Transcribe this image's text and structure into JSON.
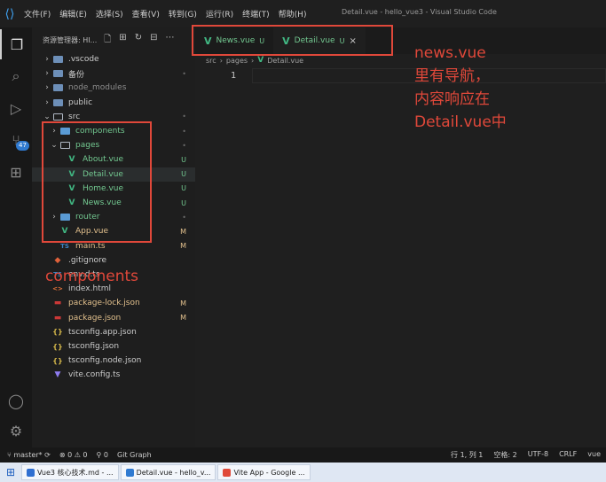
{
  "app": {
    "window_title": "Detail.vue - hello_vue3 - Visual Studio Code",
    "menu": [
      "文件(F)",
      "编辑(E)",
      "选择(S)",
      "查看(V)",
      "转到(G)",
      "运行(R)",
      "终端(T)",
      "帮助(H)"
    ]
  },
  "activity_bar": {
    "scm_badge": "47"
  },
  "explorer": {
    "header": "资源管理器: HI...",
    "tree": [
      {
        "label": ".vscode",
        "kind": "folder",
        "depth": 0,
        "chev": "›",
        "status": "",
        "color": "#cccccc"
      },
      {
        "label": "备份",
        "kind": "folder",
        "depth": 0,
        "chev": "›",
        "status": "•",
        "color": "#cccccc"
      },
      {
        "label": "node_modules",
        "kind": "folder",
        "depth": 0,
        "chev": "›",
        "status": "",
        "color": "#8c8c8c"
      },
      {
        "label": "public",
        "kind": "folder",
        "depth": 0,
        "chev": "›",
        "status": "",
        "color": "#cccccc"
      },
      {
        "label": "src",
        "kind": "folder-open",
        "depth": 0,
        "chev": "⌄",
        "status": "•",
        "color": "#cccccc"
      },
      {
        "label": "components",
        "kind": "folder",
        "depth": 1,
        "chev": "›",
        "status": "•",
        "color": "#73c991"
      },
      {
        "label": "pages",
        "kind": "folder-open",
        "depth": 1,
        "chev": "⌄",
        "status": "•",
        "color": "#73c991"
      },
      {
        "label": "About.vue",
        "kind": "vue",
        "depth": 2,
        "chev": "",
        "status": "U",
        "color": "#73c991"
      },
      {
        "label": "Detail.vue",
        "kind": "vue",
        "depth": 2,
        "chev": "",
        "status": "U",
        "color": "#73c991",
        "selected": true
      },
      {
        "label": "Home.vue",
        "kind": "vue",
        "depth": 2,
        "chev": "",
        "status": "U",
        "color": "#73c991"
      },
      {
        "label": "News.vue",
        "kind": "vue",
        "depth": 2,
        "chev": "",
        "status": "U",
        "color": "#73c991"
      },
      {
        "label": "router",
        "kind": "folder",
        "depth": 1,
        "chev": "›",
        "status": "•",
        "color": "#73c991"
      },
      {
        "label": "App.vue",
        "kind": "vue",
        "depth": 1,
        "chev": "",
        "status": "M",
        "color": "#e2c08d"
      },
      {
        "label": "main.ts",
        "kind": "ts",
        "depth": 1,
        "chev": "",
        "status": "M",
        "color": "#e2c08d"
      },
      {
        "label": ".gitignore",
        "kind": "git",
        "depth": 0,
        "chev": "",
        "status": "",
        "color": "#cccccc"
      },
      {
        "label": "env.d.ts",
        "kind": "ts",
        "depth": 0,
        "chev": "",
        "status": "",
        "color": "#cccccc"
      },
      {
        "label": "index.html",
        "kind": "html",
        "depth": 0,
        "chev": "",
        "status": "",
        "color": "#cccccc"
      },
      {
        "label": "package-lock.json",
        "kind": "npm",
        "depth": 0,
        "chev": "",
        "status": "M",
        "color": "#e2c08d"
      },
      {
        "label": "package.json",
        "kind": "npm",
        "depth": 0,
        "chev": "",
        "status": "M",
        "color": "#e2c08d"
      },
      {
        "label": "tsconfig.app.json",
        "kind": "json",
        "depth": 0,
        "chev": "",
        "status": "",
        "color": "#cccccc"
      },
      {
        "label": "tsconfig.json",
        "kind": "json",
        "depth": 0,
        "chev": "",
        "status": "",
        "color": "#cccccc"
      },
      {
        "label": "tsconfig.node.json",
        "kind": "json",
        "depth": 0,
        "chev": "",
        "status": "",
        "color": "#cccccc"
      },
      {
        "label": "vite.config.ts",
        "kind": "vite",
        "depth": 0,
        "chev": "",
        "status": "",
        "color": "#cccccc"
      }
    ]
  },
  "tabs": [
    {
      "label": "News.vue",
      "status": "U",
      "active": false
    },
    {
      "label": "Detail.vue",
      "status": "U",
      "active": true,
      "close": "×"
    }
  ],
  "editor": {
    "breadcrumb": [
      "src",
      "pages",
      "Detail.vue"
    ],
    "line_number": "1"
  },
  "annotations": {
    "right_lines": [
      "news.vue",
      "里有导航，",
      "内容响应在",
      "Detail.vue中"
    ],
    "left_label": "components"
  },
  "statusbar": {
    "branch": "master*",
    "errors": "0",
    "warnings": "0",
    "ports": "0",
    "git_graph": "Git Graph",
    "position": "行 1, 列 1",
    "spaces": "空格: 2",
    "encoding": "UTF-8",
    "eol": "CRLF",
    "language": "vue"
  },
  "taskbar": [
    {
      "label": "Vue3 核心技术.md - ...",
      "color": "#2f6fd1"
    },
    {
      "label": "Detail.vue - hello_v...",
      "color": "#2f7ad1"
    },
    {
      "label": "Vite App - Google ...",
      "color": "#e04a3a"
    }
  ],
  "colors": {
    "annotation": "#e0483a",
    "vue_green": "#41b883",
    "untracked": "#73c991",
    "modified": "#e2c08d"
  }
}
